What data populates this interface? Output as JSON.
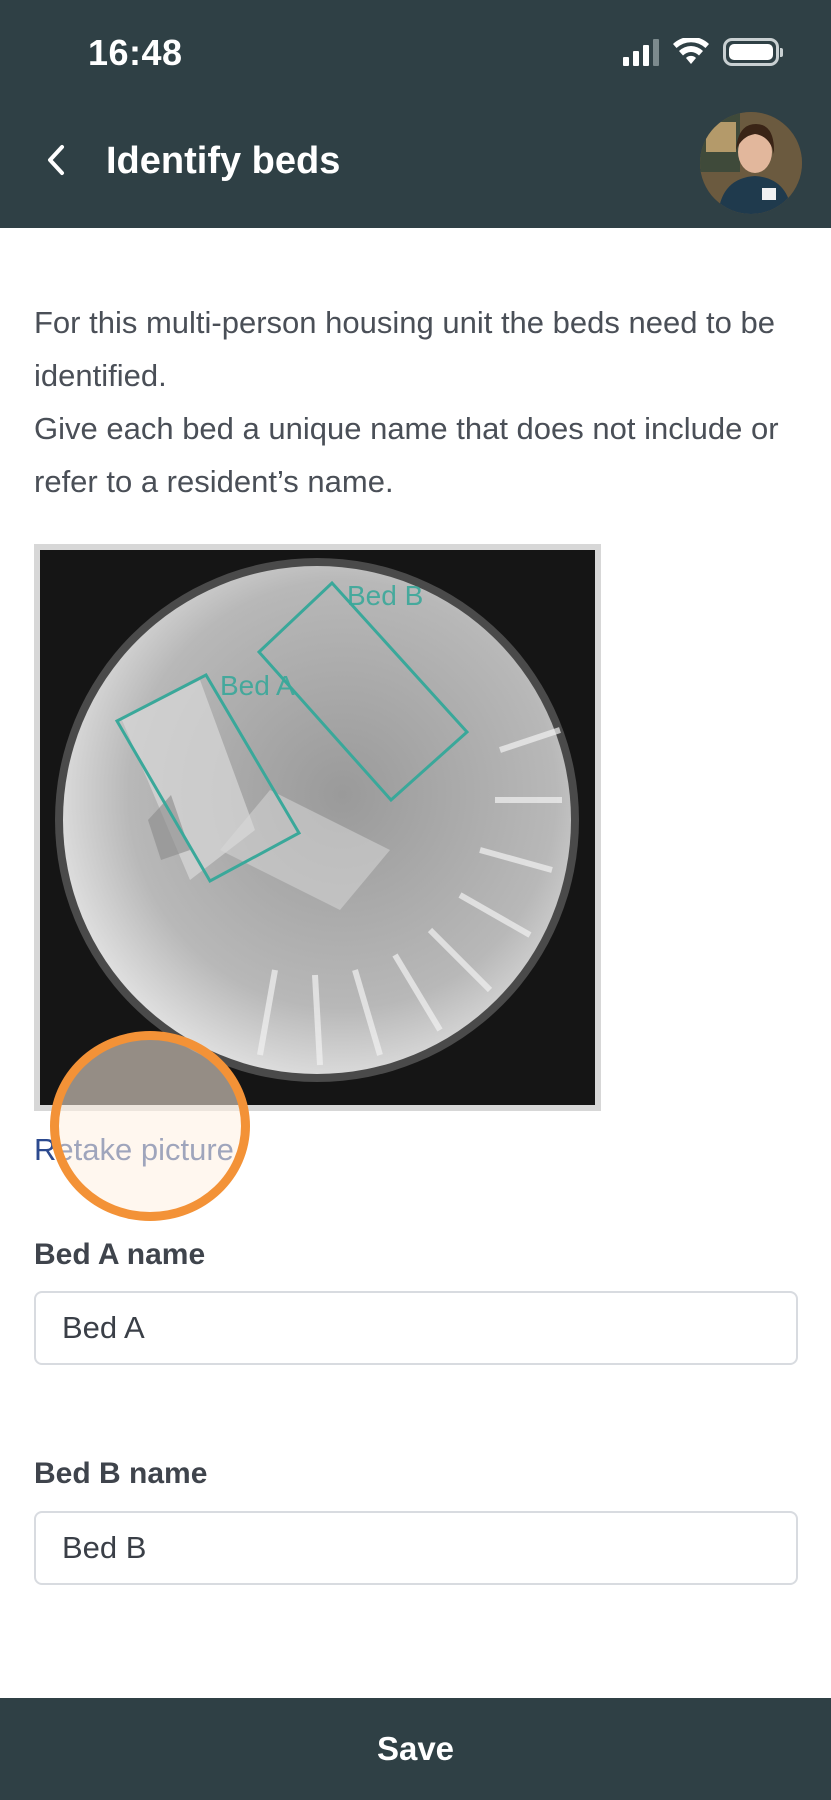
{
  "status_bar": {
    "time": "16:48",
    "icons": [
      "cellular-signal-icon",
      "wifi-icon",
      "battery-icon"
    ]
  },
  "header": {
    "back_icon": "chevron-left-icon",
    "title": "Identify beds",
    "avatar": "user-avatar"
  },
  "intro": {
    "line1": "For this multi-person housing unit the beds need to be identified.",
    "line2": "Give each bed a unique name that does not include or refer to a resident’s name."
  },
  "photo": {
    "overlay_labels": [
      "Bed A",
      "Bed B"
    ],
    "overlay_color": "#3aa89a"
  },
  "retake_label": "Retake picture",
  "fields": [
    {
      "label": "Bed A name",
      "value": "Bed A"
    },
    {
      "label": "Bed B name",
      "value": "Bed B"
    }
  ],
  "save_label": "Save",
  "colors": {
    "header_bg": "#2f4045",
    "link": "#2c4a8f",
    "tap_indicator": "#f39237"
  }
}
